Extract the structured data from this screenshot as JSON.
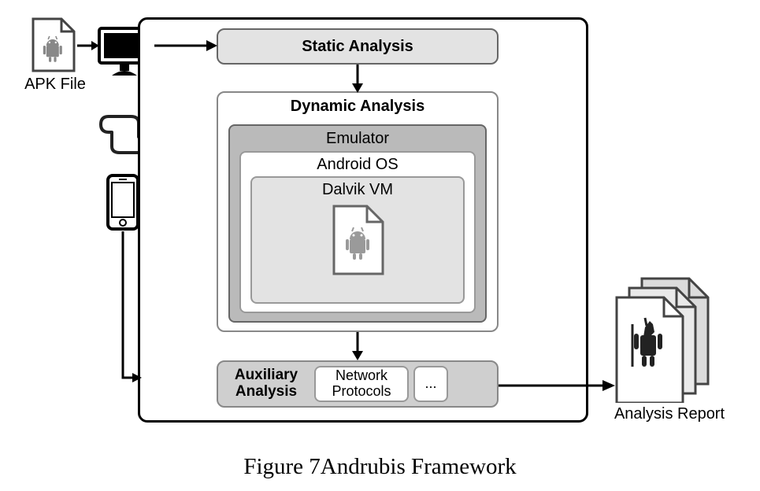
{
  "apk": {
    "label": "APK File"
  },
  "frame": {
    "static": "Static Analysis",
    "dynamic": "Dynamic Analysis",
    "emulator": "Emulator",
    "android_os": "Android OS",
    "dalvik": "Dalvik VM",
    "auxiliary": "Auxiliary\nAnalysis",
    "network": "Network\nProtocols",
    "etc": "..."
  },
  "report": {
    "label": "Analysis Report"
  },
  "figure": {
    "caption": "Figure 7Andrubis Framework"
  }
}
